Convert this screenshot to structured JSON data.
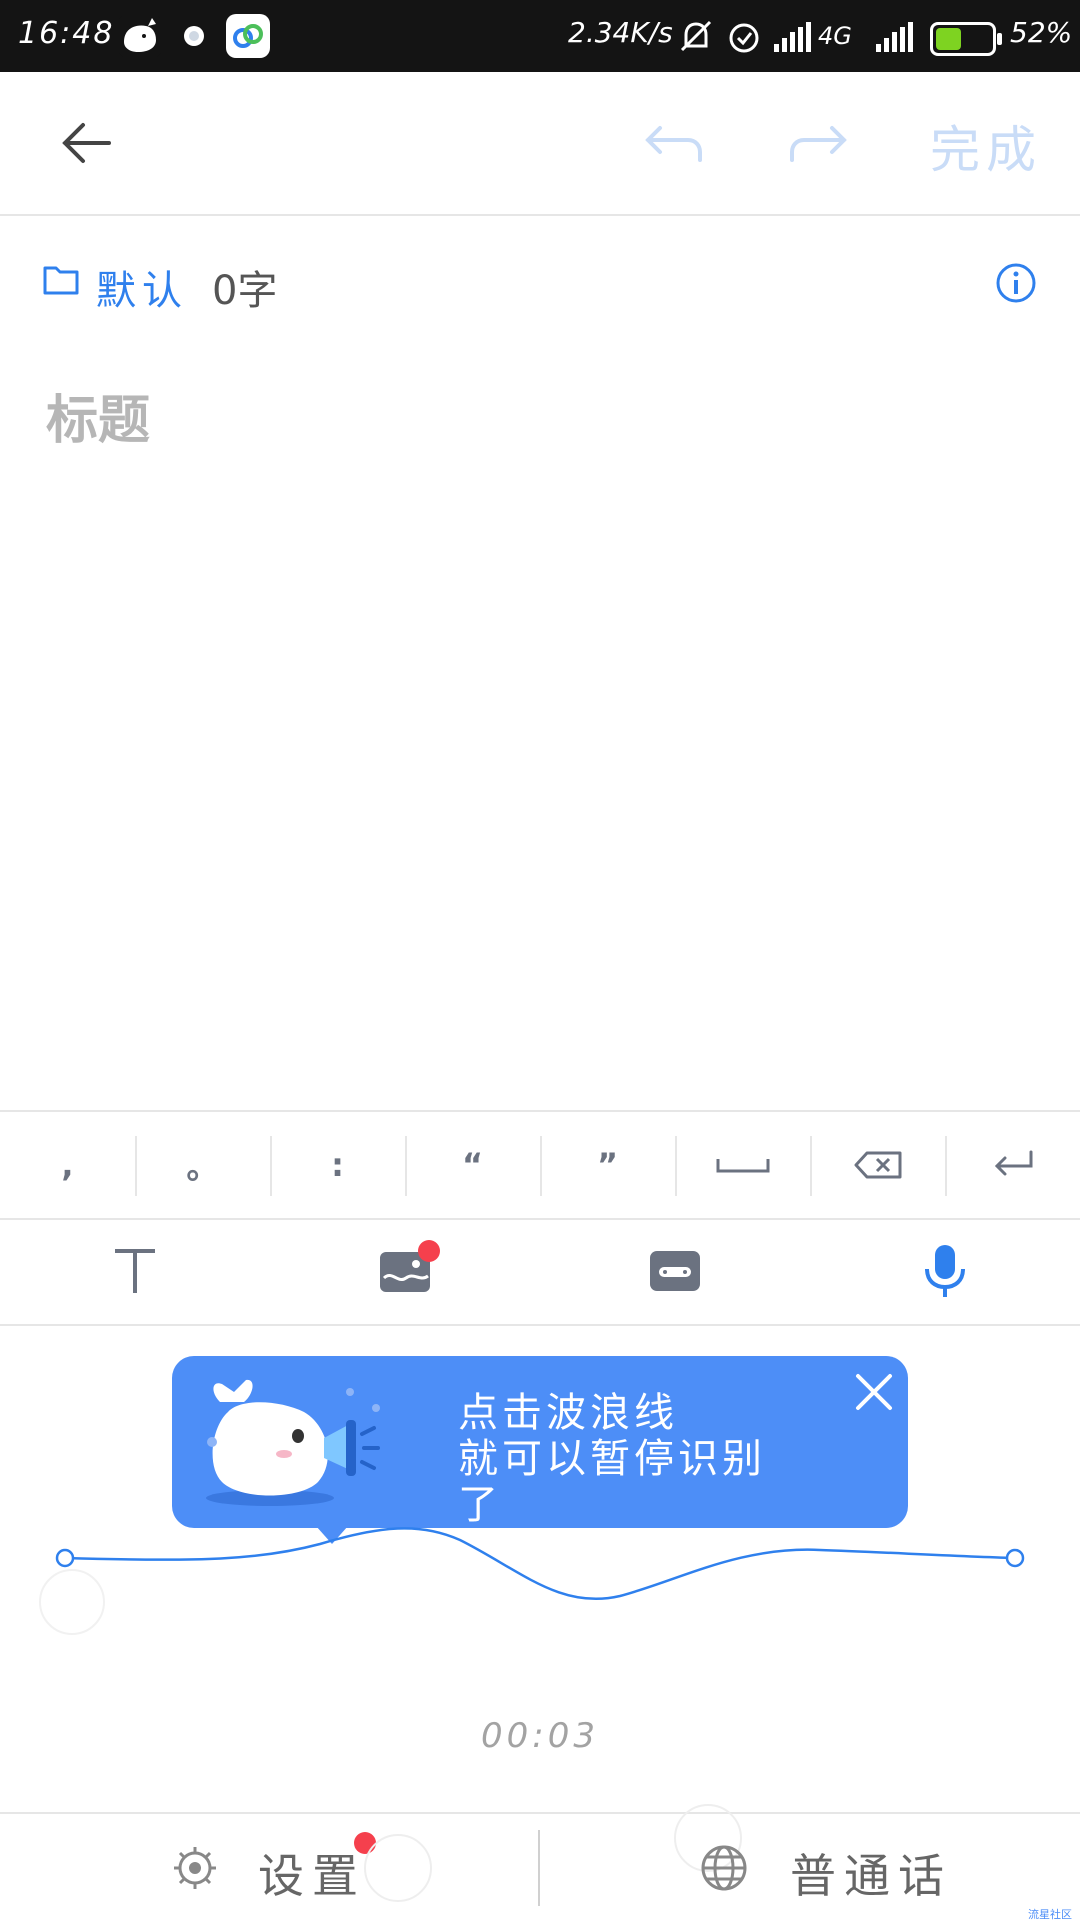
{
  "status_bar": {
    "time": "16:48",
    "net_speed": "2.34K/s",
    "network": "4G",
    "battery": "52%",
    "icons": [
      "whale-app-icon",
      "chat-app-icon",
      "baidu-cloud-icon",
      "mute-bell-icon",
      "alarm-icon",
      "signal-icon",
      "battery-icon"
    ],
    "battery_fill_fraction": 0.52
  },
  "toolbar": {
    "back_icon": "arrow-left-icon",
    "undo_icon": "undo-icon",
    "redo_icon": "redo-icon",
    "done_label": "完成"
  },
  "note_meta": {
    "folder_icon": "folder-icon",
    "folder_name": "默认",
    "word_count": "0字",
    "info_icon": "info-icon"
  },
  "editor": {
    "title_placeholder": "标题"
  },
  "punctuation_bar": {
    "keys": [
      ",",
      "。",
      ":",
      "“",
      "”",
      "space",
      "backspace",
      "enter"
    ]
  },
  "tool_bar": {
    "tools": [
      "text-format-icon",
      "image-icon",
      "keyboard-icon",
      "microphone-icon"
    ],
    "image_has_badge": true
  },
  "voice_tip": {
    "text_line1": "点击波浪线",
    "text_line2": "就可以暂停识别",
    "text_line3": "了",
    "close_icon": "close-icon"
  },
  "recording": {
    "timer": "00:03"
  },
  "bottom_bar": {
    "settings_label": "设置",
    "language_label": "普通话",
    "settings_has_badge": true
  },
  "watermark": "流星社区",
  "colors": {
    "accent": "#2f80ed",
    "banner": "#4d8ef7",
    "done_disabled": "#c9dcf7",
    "badge": "#f5404d"
  }
}
